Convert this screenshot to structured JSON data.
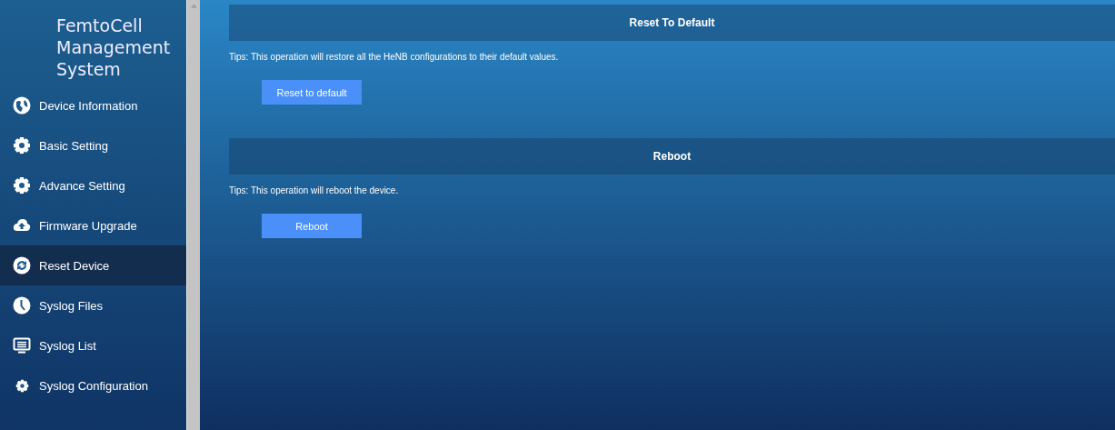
{
  "sidebar": {
    "title": [
      "FemtoCell",
      "Management",
      "System"
    ],
    "items": [
      {
        "label": "Device Information",
        "selected": false
      },
      {
        "label": "Basic Setting",
        "selected": false
      },
      {
        "label": "Advance Setting",
        "selected": false
      },
      {
        "label": "Firmware Upgrade",
        "selected": false
      },
      {
        "label": "Reset Device",
        "selected": true
      },
      {
        "label": "Syslog Files",
        "selected": false
      },
      {
        "label": "Syslog List",
        "selected": false
      },
      {
        "label": "Syslog Configuration",
        "selected": false
      }
    ]
  },
  "sections": [
    {
      "heading": "Reset To Default",
      "tips": "Tips: This operation will restore all the HeNB configurations to their default values.",
      "button": "Reset to default"
    },
    {
      "heading": "Reboot",
      "tips": "Tips: This operation will reboot the device.",
      "button": "Reboot"
    }
  ]
}
